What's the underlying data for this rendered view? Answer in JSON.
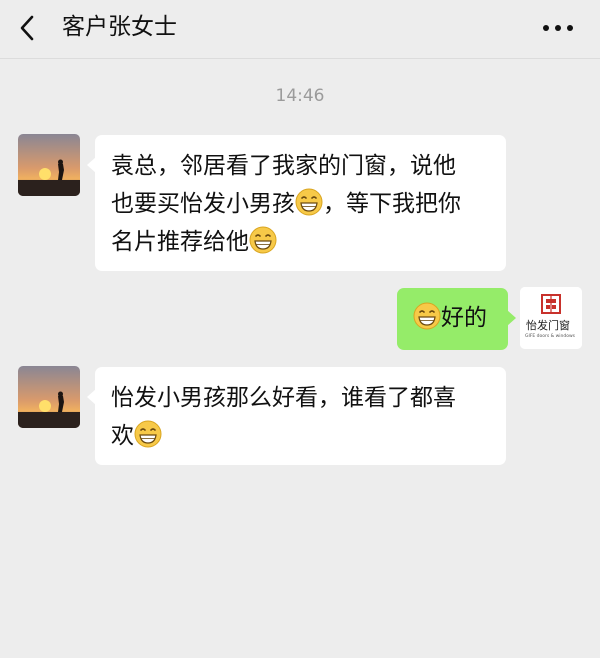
{
  "header": {
    "title": "客户张女士",
    "back_icon": "chevron-left-icon",
    "more_icon": "more-dots-icon"
  },
  "timestamp": "14:46",
  "messages": [
    {
      "side": "left",
      "sender": "client",
      "lines": [
        "袁总，邻居看了我家的门窗，说他",
        "也要买怡发小男孩",
        "，等下我把你",
        "名片推荐给他"
      ]
    },
    {
      "side": "right",
      "sender": "me",
      "text": "好的"
    },
    {
      "side": "left",
      "sender": "client",
      "lines": [
        "怡发小男孩那么好看，谁看了都喜",
        "欢"
      ]
    }
  ],
  "brand_avatar": {
    "name": "怡发门窗",
    "subtitle": "GIFE doors & windows"
  },
  "colors": {
    "background": "#ededed",
    "bubble_incoming": "#ffffff",
    "bubble_outgoing": "#95ec69",
    "brand_red": "#c8312b"
  }
}
